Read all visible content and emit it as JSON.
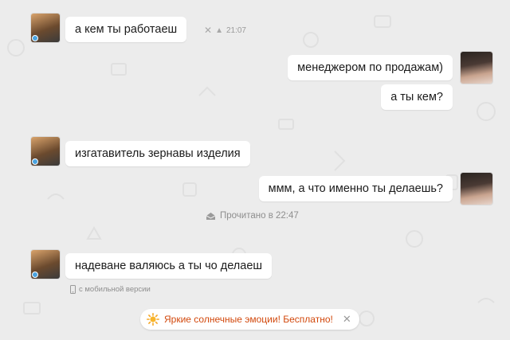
{
  "messages": [
    {
      "text": "а кем ты работаеш",
      "sender": "male",
      "time": "21:07"
    },
    {
      "text": "менеджером по продажам)",
      "sender": "female"
    },
    {
      "text": "а ты кем?",
      "sender": "female"
    },
    {
      "text": "изгатавитель зернавы изделия",
      "sender": "male"
    },
    {
      "text": "ммм, а что именно ты делаешь?",
      "sender": "female"
    },
    {
      "text": "надеване валяюсь а ты чо делаеш",
      "sender": "male"
    }
  ],
  "status": {
    "read": "Прочитано в 22:47",
    "mobile": "с мобильной версии"
  },
  "promo": {
    "text": "Яркие солнечные эмоции! Бесплатно!",
    "color": "#d2480c"
  },
  "colors": {
    "background": "#ececec",
    "bubble": "#ffffff",
    "online_dot": "#4aa3e0"
  },
  "icons": {
    "delete": "close-icon",
    "report": "warning-icon",
    "read": "envelope-read-icon",
    "mobile": "phone-icon",
    "promo": "sun-icon"
  }
}
